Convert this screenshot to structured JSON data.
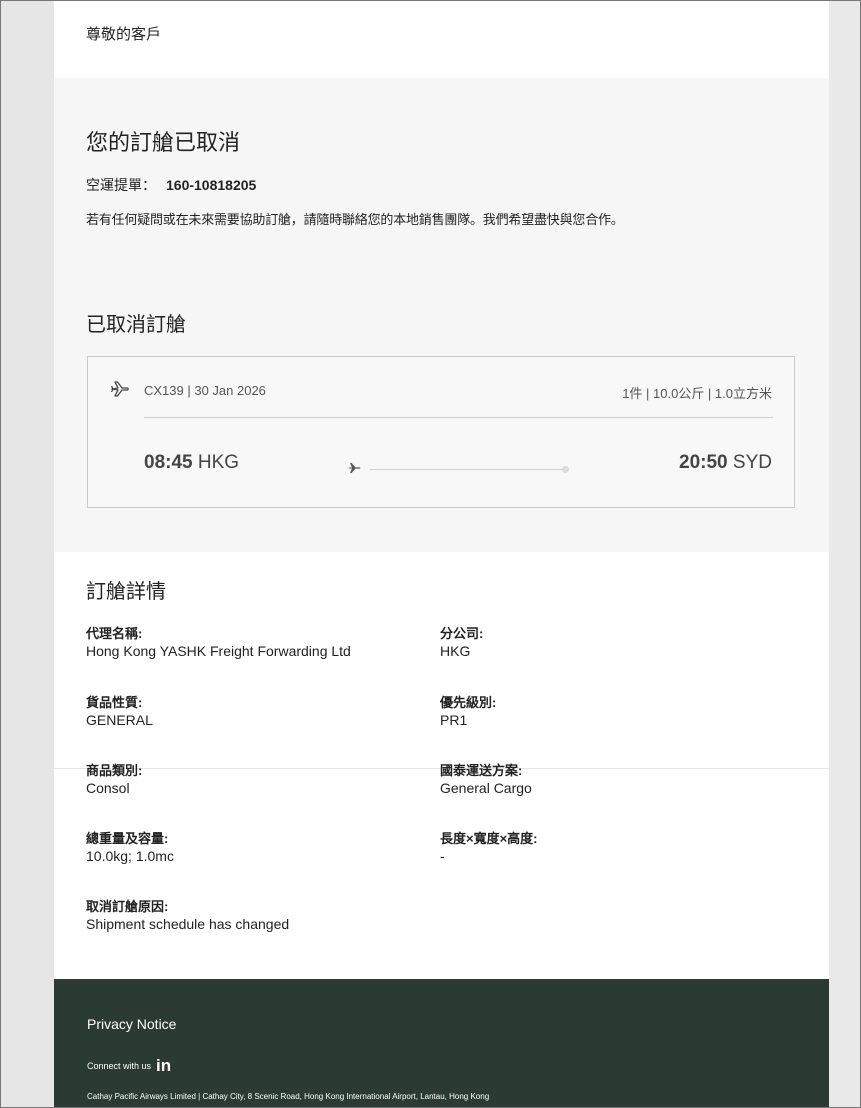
{
  "greeting": "尊敬的客戶",
  "cancellation": {
    "title": "您的訂艙已取消",
    "awb_label": "空運提單：",
    "awb_number": "160-10818205",
    "notice": "若有任何疑問或在未來需要協助訂艙，請隨時聯絡您的本地銷售團隊。我們希望盡快與您合作。"
  },
  "cancelled_booking": {
    "heading": "已取消訂艙",
    "flight": "CX139 | 30 Jan 2026",
    "shipment": "1件 | 10.0公斤 | 1.0立方米",
    "departure_time": "08:45",
    "departure_airport": "HKG",
    "arrival_time": "20:50",
    "arrival_airport": "SYD"
  },
  "details": {
    "heading": "訂艙詳情",
    "agent_label": "代理名稱:",
    "agent_value": "Hong Kong YASHK Freight Forwarding Ltd",
    "branch_label": "分公司:",
    "branch_value": "HKG",
    "nature_label": "貨品性質:",
    "nature_value": "GENERAL",
    "priority_label": "優先級別:",
    "priority_value": "PR1",
    "commodity_label": "商品類別:",
    "commodity_value": "Consol",
    "product_label": "國泰運送方案:",
    "product_value": "General Cargo",
    "weight_label": "總重量及容量:",
    "weight_value": "10.0kg; 1.0mc",
    "dims_label": "長度×寬度×高度:",
    "dims_value": "-",
    "reason_label": "取消訂艙原因:",
    "reason_value": "Shipment schedule has changed"
  },
  "footer": {
    "privacy": "Privacy Notice",
    "connect": "Connect with us",
    "linkedin": "in",
    "address": "Cathay Pacific Airways Limited | Cathay City, 8 Scenic Road, Hong Kong International Airport, Lantau, Hong Kong"
  },
  "colors": {
    "footer_bg": "#2b3a33",
    "section_bg": "#f6f6f6",
    "card_border": "#c9c9c9"
  },
  "icons": {
    "flight": "plane-icon",
    "route": "plane-icon",
    "social": "linkedin-icon"
  }
}
